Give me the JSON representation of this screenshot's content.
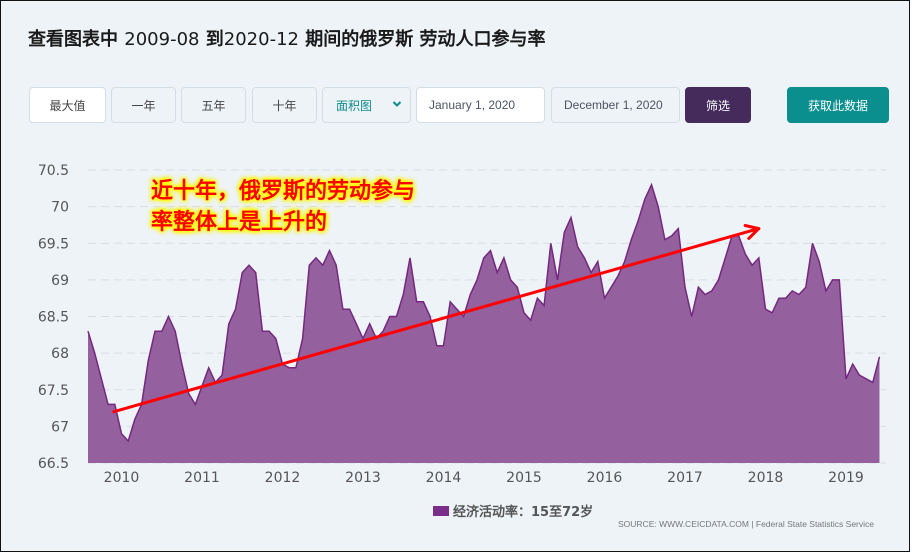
{
  "header": {
    "title_prefix": "查看图表中",
    "title_start": "2009-08",
    "title_mid": "到",
    "title_end": "2020-12",
    "title_suffix": "期间的俄罗斯 劳动人口参与率"
  },
  "toolbar": {
    "range_buttons": [
      {
        "label": "最大值",
        "active": true
      },
      {
        "label": "一年",
        "active": false
      },
      {
        "label": "五年",
        "active": false
      },
      {
        "label": "十年",
        "active": false
      }
    ],
    "chart_type": {
      "selected": "面积图",
      "icon": "chevron-down-icon"
    },
    "start_date": "January 1, 2020",
    "end_date": "December 1, 2020",
    "filter_label": "筛选",
    "get_data_label": "获取此数据"
  },
  "colors": {
    "area_fill": "#95609e",
    "area_line": "#74287f",
    "legend_swatch": "#7a2e8a",
    "filter_button": "#452b5b",
    "get_data_button": "#0a8e8e",
    "annotation_text": "#ff0000",
    "annotation_glow": "#ffff00",
    "trend_arrow": "#ff0000"
  },
  "annotation": {
    "line1": "近十年，俄罗斯的劳动参与",
    "line2": "率整体上是上升的"
  },
  "legend": {
    "label": "经济活动率：15至72岁"
  },
  "source": "SOURCE: WWW.CEICDATA.COM | Federal State Statistics Service",
  "chart_data": {
    "type": "area",
    "title": "俄罗斯 劳动人口参与率",
    "xlabel": "",
    "ylabel": "",
    "ylim": [
      66.5,
      70.5
    ],
    "yticks": [
      66.5,
      67,
      67.5,
      68,
      68.5,
      69,
      69.5,
      70,
      70.5
    ],
    "ytick_labels": [
      "66.5",
      "67",
      "67.5",
      "68",
      "68.5",
      "69",
      "69.5",
      "70",
      "70.5"
    ],
    "xticks": [
      2010,
      2011,
      2012,
      2013,
      2014,
      2015,
      2016,
      2017,
      2018,
      2019
    ],
    "xtick_labels": [
      "2010",
      "2011",
      "2012",
      "2013",
      "2014",
      "2015",
      "2016",
      "2017",
      "2018",
      "2019"
    ],
    "x_start": "2009-08",
    "x_step": "monthly",
    "grid": true,
    "legend_position": "bottom-center",
    "series": [
      {
        "name": "经济活动率：15至72岁",
        "values": [
          68.3,
          68.0,
          67.65,
          67.3,
          67.3,
          66.9,
          66.8,
          67.1,
          67.3,
          67.9,
          68.3,
          68.3,
          68.5,
          68.3,
          67.85,
          67.45,
          67.3,
          67.55,
          67.8,
          67.6,
          67.7,
          68.4,
          68.6,
          69.1,
          69.2,
          69.1,
          68.3,
          68.3,
          68.2,
          67.85,
          67.8,
          67.8,
          68.2,
          69.2,
          69.3,
          69.2,
          69.4,
          69.2,
          68.6,
          68.6,
          68.4,
          68.2,
          68.4,
          68.2,
          68.3,
          68.5,
          68.5,
          68.8,
          69.3,
          68.7,
          68.7,
          68.5,
          68.1,
          68.1,
          68.7,
          68.6,
          68.5,
          68.8,
          69.0,
          69.3,
          69.4,
          69.1,
          69.3,
          69.0,
          68.9,
          68.55,
          68.45,
          68.75,
          68.65,
          69.5,
          69.0,
          69.65,
          69.85,
          69.45,
          69.3,
          69.1,
          69.25,
          68.75,
          68.9,
          69.05,
          69.25,
          69.55,
          69.8,
          70.1,
          70.3,
          70.0,
          69.55,
          69.6,
          69.7,
          68.9,
          68.5,
          68.9,
          68.8,
          68.85,
          69.0,
          69.3,
          69.6,
          69.6,
          69.35,
          69.2,
          69.3,
          68.6,
          68.55,
          68.75,
          68.75,
          68.85,
          68.8,
          68.9,
          69.5,
          69.25,
          68.85,
          69.0,
          69.0,
          67.65,
          67.85,
          67.7,
          67.65,
          67.6,
          67.95
        ]
      }
    ],
    "annotations": [
      {
        "type": "arrow",
        "from": {
          "x": "2009-12",
          "y": 67.2
        },
        "to": {
          "x": "2017-12",
          "y": 69.7
        },
        "meaning": "upward trend"
      }
    ]
  }
}
